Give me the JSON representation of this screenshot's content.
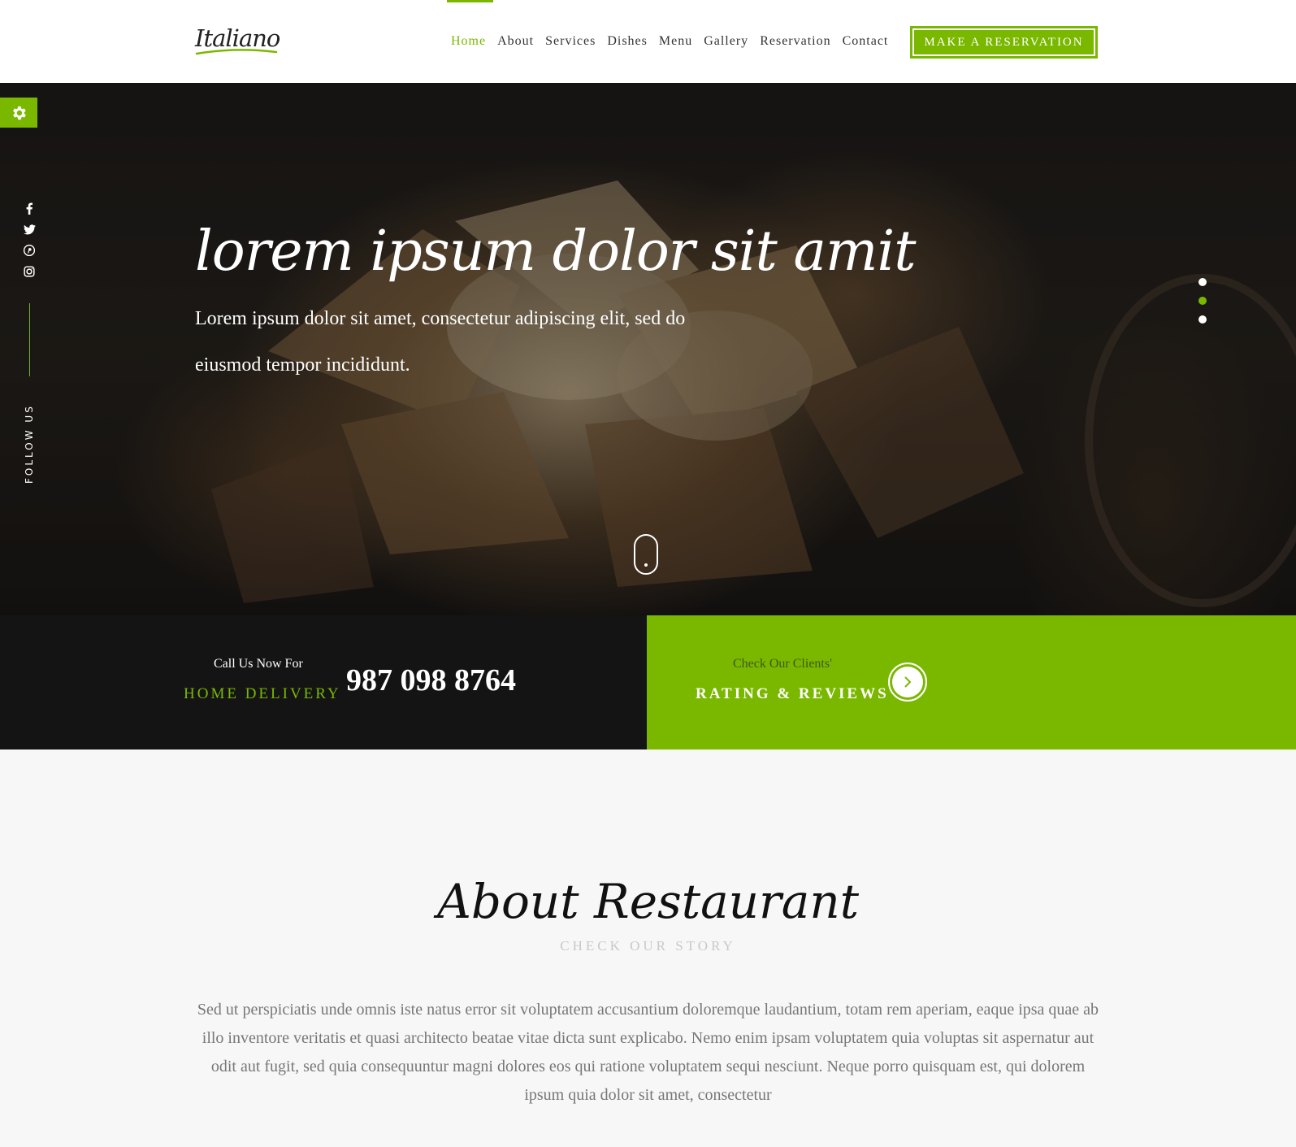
{
  "header": {
    "logo": "Italiano",
    "nav": [
      "Home",
      "About",
      "Services",
      "Dishes",
      "Menu",
      "Gallery",
      "Reservation",
      "Contact"
    ],
    "active_nav": "Home",
    "cta_label": "MAKE A RESERVATION"
  },
  "sidebar": {
    "settings_icon": "gear-icon",
    "social_icons": [
      "facebook-icon",
      "twitter-icon",
      "pinterest-icon",
      "instagram-icon"
    ],
    "follow_label": "FOLLOW US"
  },
  "hero": {
    "title": "lorem ipsum dolor sit amit",
    "text": "Lorem ipsum dolor sit amet, consectetur adipiscing elit, sed do eiusmod tempor incididunt.",
    "slides": 3,
    "active_slide": 2
  },
  "band": {
    "call_small": "Call Us Now For",
    "call_big": "HOME DELIVERY",
    "phone": "987 098 8764",
    "reviews_small": "Check Our Clients'",
    "reviews_big": "RATING & REVIEWS"
  },
  "about": {
    "title": "About Restaurant",
    "subtitle": "CHECK OUR STORY",
    "text": "Sed ut perspiciatis unde omnis iste natus error sit voluptatem accusantium doloremque laudantium, totam rem aperiam, eaque ipsa quae ab illo inventore veritatis et quasi architecto beatae vitae dicta sunt explicabo. Nemo enim ipsam voluptatem quia voluptas sit aspernatur aut odit aut fugit, sed quia consequuntur magni dolores eos qui ratione voluptatem sequi nesciunt. Neque porro quisquam est, qui dolorem ipsum quia dolor sit amet, consectetur"
  },
  "colors": {
    "accent": "#7ab800",
    "dark_band": "#141414",
    "header_bg": "#ffffff"
  }
}
